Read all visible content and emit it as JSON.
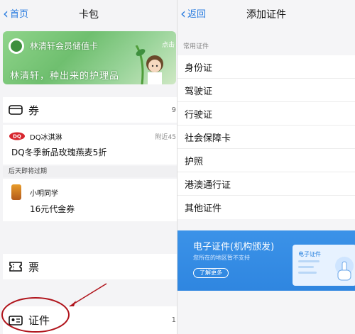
{
  "left": {
    "nav": {
      "back_label": "首页",
      "title": "卡包"
    },
    "member_card": {
      "name": "林清轩会员储值卡",
      "slogan": "林清轩，种出来的护理品",
      "badge": "点击"
    },
    "coupons": {
      "label": "券",
      "count": "9",
      "items": [
        {
          "brand": "DQ冰淇淋",
          "title": "DQ冬季新品玫瑰燕麦5折",
          "nearby": "附近45"
        },
        {
          "brand": "小明同学",
          "title": "16元代金券"
        }
      ],
      "expiring_label": "后天即将过期"
    },
    "tickets": {
      "label": "票"
    },
    "ids": {
      "label": "证件",
      "count": "1"
    }
  },
  "right": {
    "nav": {
      "back_label": "返回",
      "title": "添加证件"
    },
    "list_header": "常用证件",
    "items": [
      "身份证",
      "驾驶证",
      "行驶证",
      "社会保障卡",
      "护照",
      "港澳通行证",
      "其他证件"
    ],
    "eid_banner": {
      "title": "电子证件(机构颁发)",
      "subtitle": "您所在的地区暂不支持",
      "button": "了解更多",
      "card_title": "电子证件"
    }
  },
  "colors": {
    "accent": "#2b7de0",
    "banner": "#2f86e0",
    "card_green": "#6fbf6f",
    "circle": "#b0141c"
  }
}
